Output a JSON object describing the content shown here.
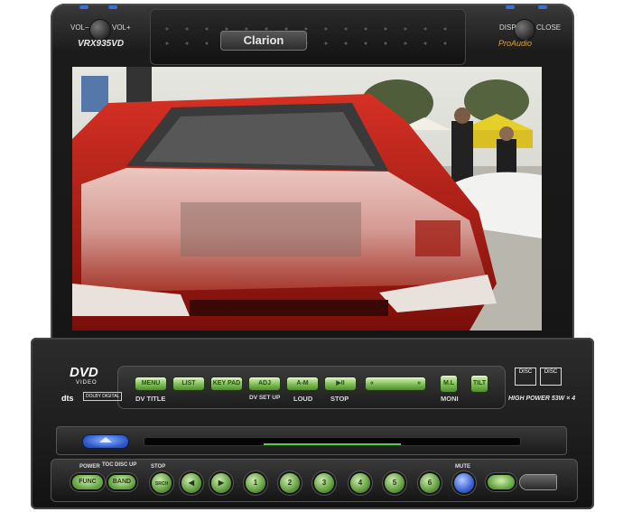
{
  "header": {
    "brand": "Clarion",
    "model": "VRX935VD",
    "series": "ProAudio",
    "vol_minus": "VOL−",
    "vol_plus": "VOL+",
    "disp": "DISP",
    "close": "CLOSE"
  },
  "screen": {
    "content": "photo-red-sports-car-hood",
    "colors": {
      "car": "#c21f1f",
      "sky": "#dcdcd6",
      "tent": "#e7cf2a"
    }
  },
  "panel": {
    "dvd_logo": "DVD",
    "dvd_sub": "VIDEO",
    "dts_logo": "dts",
    "dolby_logo": "DOLBY DIGITAL",
    "buttons": [
      {
        "label": "MENU",
        "sub_label": "DV TITLE"
      },
      {
        "label": "LIST",
        "sub_label": ""
      },
      {
        "label": "KEY PAD",
        "sub_label": ""
      },
      {
        "label": "ADJ",
        "sub_label": "DV SET UP"
      },
      {
        "label": "A-M",
        "sub_label": "LOUD"
      },
      {
        "label": "▶II",
        "sub_label": "STOP"
      }
    ],
    "seek_left": "«",
    "seek_right": "»",
    "ml_button": "M.L",
    "moni_label": "MONI",
    "tilt_button": "TILT",
    "high_power": "HIGH POWER 53W × 4",
    "cd_logo_1": "DISC",
    "cd_logo_2": "DISC"
  },
  "bottom": {
    "power_label": "POWER",
    "func_label": "FUNC",
    "toc_label": "TOC",
    "disc_up_label": "DISC UP",
    "band_label": "BAND",
    "stop_label": "STOP",
    "mute_label": "MUTE",
    "numbers": [
      "1",
      "2",
      "3",
      "4",
      "5",
      "6"
    ],
    "search_label": "SRCH"
  }
}
